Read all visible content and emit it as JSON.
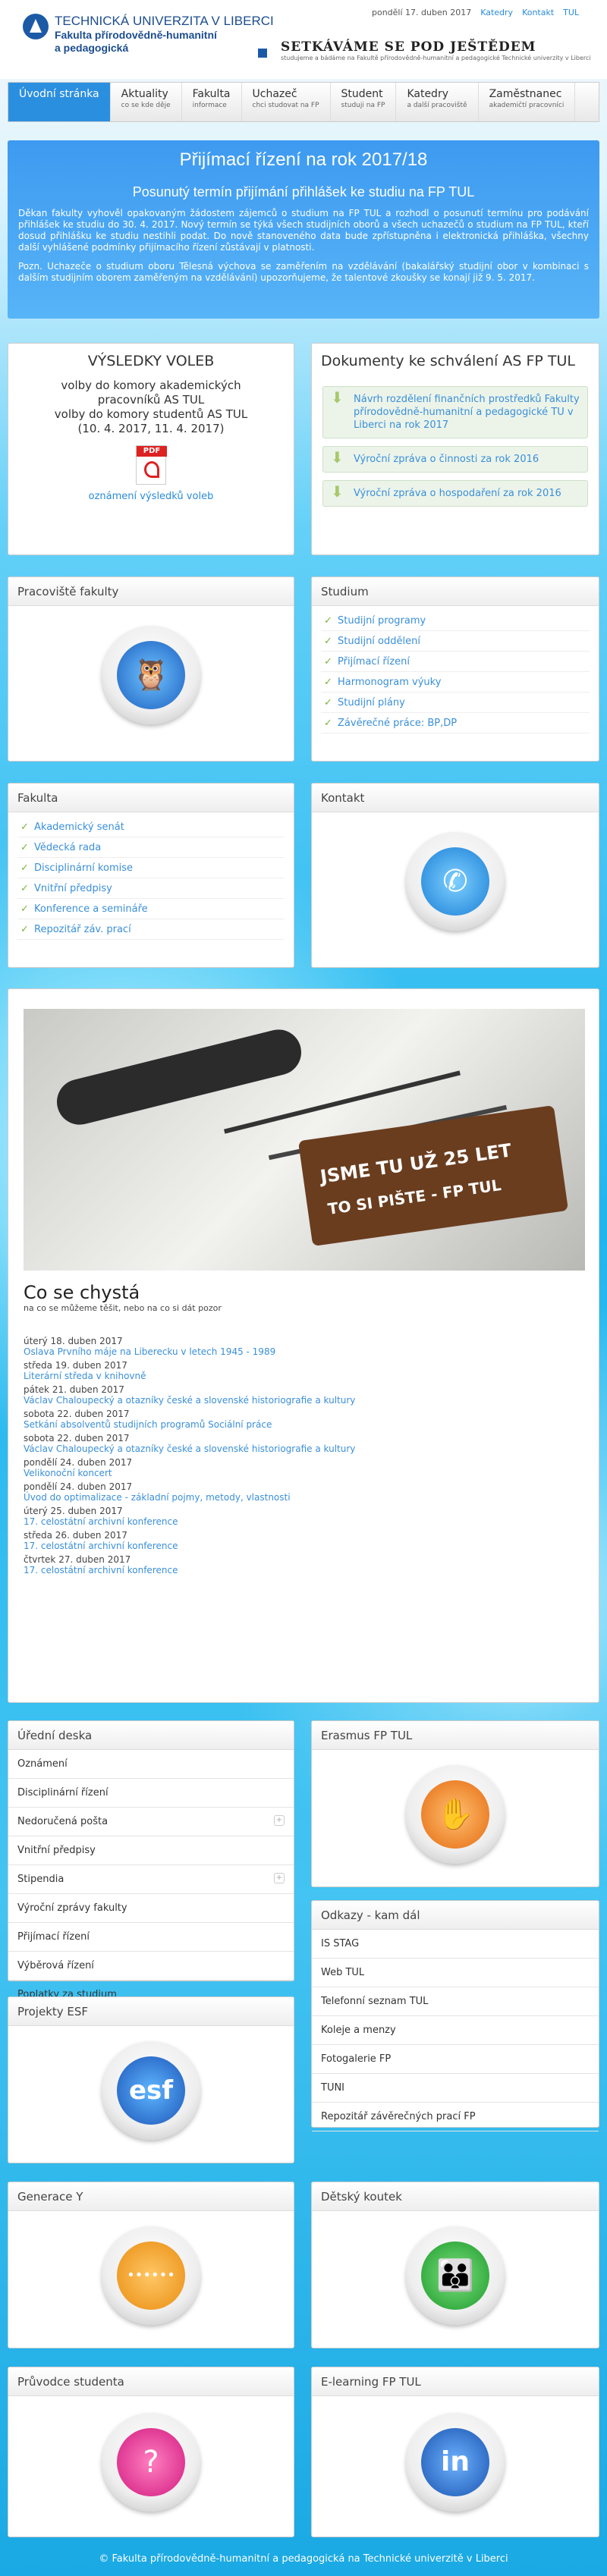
{
  "header": {
    "uni": "TECHNICKÁ UNIVERZITA V LIBERCI",
    "fac1": "Fakulta přírodovědně-humanitní",
    "fac2": "a pedagogická",
    "date": "pondělí 17. duben 2017",
    "links": [
      "Katedry",
      "Kontakt",
      "TUL"
    ],
    "slogan": "SETKÁVÁME SE POD JEŠTĚDEM",
    "slogan_sub": "studujeme a bádáme na Fakultě přírodovědně-humanitní a pedagogické Technické univerzity v Liberci"
  },
  "nav": [
    {
      "label": "Úvodní stránka",
      "sub": ""
    },
    {
      "label": "Aktuality",
      "sub": "co se kde děje"
    },
    {
      "label": "Fakulta",
      "sub": "informace"
    },
    {
      "label": "Uchazeč",
      "sub": "chci studovat na FP"
    },
    {
      "label": "Student",
      "sub": "studuji na FP"
    },
    {
      "label": "Katedry",
      "sub": "a další pracoviště"
    },
    {
      "label": "Zaměstnanec",
      "sub": "akademičtí pracovníci"
    }
  ],
  "notice": {
    "title": "Přijímací řízení na rok 2017/18",
    "subtitle": "Posunutý termín přijímání přihlášek ke studiu na FP TUL",
    "p1": "Děkan fakulty vyhověl opakovaným žádostem zájemců o studium na FP TUL a rozhodl o posunutí termínu pro podávání přihlášek ke studiu do 30. 4. 2017. Nový termín se týká všech studijních oborů a všech uchazečů o studium na FP TUL, kteří dosud přihlášku ke studiu nestihli podat. Do nově stanoveného data bude zpřístupněna i elektronická přihláška, všechny další vyhlášené podmínky přijímacího řízení zůstávají v platnosti.",
    "p2": "Pozn. Uchazeče o studium oboru Tělesná výchova se zaměřením na vzdělávání (bakalářský studijní obor v kombinaci s dalším studijním oborem zaměřeným na vzdělávání) upozorňujeme, že talentové zkoušky se konají již 9. 5. 2017."
  },
  "voleb": {
    "title": "VÝSLEDKY VOLEB",
    "l1": "volby do komory akademických pracovníků AS TUL",
    "l2": "volby do komory studentů AS TUL",
    "l3": "(10. 4. 2017, 11. 4. 2017)",
    "pdf": "PDF",
    "link": "oznámení výsledků voleb"
  },
  "docs": {
    "title": "Dokumenty ke schválení AS FP TUL",
    "items": [
      "Návrh rozdělení finančních prostředků Fakulty přírodovědně-humanitní a pedagogické TU v Liberci na rok 2017",
      "Výroční zpráva o činnosti za rok 2016",
      "Výroční zpráva o hospodaření za rok 2016"
    ]
  },
  "pracoviste": {
    "title": "Pracoviště fakulty"
  },
  "studium": {
    "title": "Studium",
    "items": [
      "Studijní programy",
      "Studijní oddělení",
      "Přijímací řízení",
      "Harmonogram výuky",
      "Studijní plány",
      "Závěrečné práce: BP,DP"
    ]
  },
  "fakulta": {
    "title": "Fakulta",
    "items": [
      "Akademický senát",
      "Vědecká rada",
      "Disciplinární komise",
      "Vnitřní předpisy",
      "Konference a semináře",
      "Repozitář záv. prací"
    ]
  },
  "kontakt": {
    "title": "Kontakt"
  },
  "photo": {
    "sign1": "JSME TU UŽ 25 LET",
    "sign2": "TO SI PIŠTE - FP TUL"
  },
  "events": {
    "title": "Co se chystá",
    "sub": "na co se můžeme těšit, nebo na co si dát pozor",
    "items": [
      {
        "d": "úterý 18. duben 2017",
        "t": "Oslava Prvního máje na Liberecku v letech 1945 - 1989"
      },
      {
        "d": "středa 19. duben 2017",
        "t": "Literární středa v knihovně"
      },
      {
        "d": "pátek 21. duben 2017",
        "t": "Václav Chaloupecký a otazníky české a slovenské historiografie a kultury"
      },
      {
        "d": "sobota 22. duben 2017",
        "t": "Setkání absolventů studijních programů Sociální práce"
      },
      {
        "d": "sobota 22. duben 2017",
        "t": "Václav Chaloupecký a otazníky české a slovenské historiografie a kultury"
      },
      {
        "d": "pondělí 24. duben 2017",
        "t": "Velikonoční koncert"
      },
      {
        "d": "pondělí 24. duben 2017",
        "t": "Úvod do optimalizace - základní pojmy, metody, vlastnosti"
      },
      {
        "d": "úterý 25. duben 2017",
        "t": "17. celostátní archivní konference"
      },
      {
        "d": "středa 26. duben 2017",
        "t": "17. celostátní archivní konference"
      },
      {
        "d": "čtvrtek 27. duben 2017",
        "t": "17. celostátní archivní konference"
      }
    ]
  },
  "deska": {
    "title": "Úřední deska",
    "items": [
      "Oznámení",
      "Disciplinární řízení",
      "Nedoručená pošta",
      "Vnitřní předpisy",
      "Stipendia",
      "Výroční zprávy fakulty",
      "Přijímací řízení",
      "Výběrová řízení",
      "Poplatky za studium"
    ],
    "expand": "+"
  },
  "erasmus": {
    "title": "Erasmus FP TUL"
  },
  "odkazy": {
    "title": "Odkazy - kam dál",
    "items": [
      "IS STAG",
      "Web TUL",
      "Telefonní seznam TUL",
      "Koleje a menzy",
      "Fotogalerie FP",
      "TUNI",
      "Repozitář závěrečných prací FP"
    ]
  },
  "esf": {
    "title": "Projekty ESF",
    "logo": "esf"
  },
  "generace": {
    "title": "Generace Y"
  },
  "detsky": {
    "title": "Dětský koutek"
  },
  "pruvodce": {
    "title": "Průvodce studenta"
  },
  "elearning": {
    "title": "E-learning FP TUL",
    "logo": "in"
  },
  "icons": {
    "owl": "🦉",
    "phone": "✆",
    "hand": "✋",
    "dots": "••••••",
    "kids": "👪",
    "person": "?"
  },
  "footer": "© Fakulta přírodovědně-humanitní a pedagogická na Technické univerzitě v Liberci"
}
